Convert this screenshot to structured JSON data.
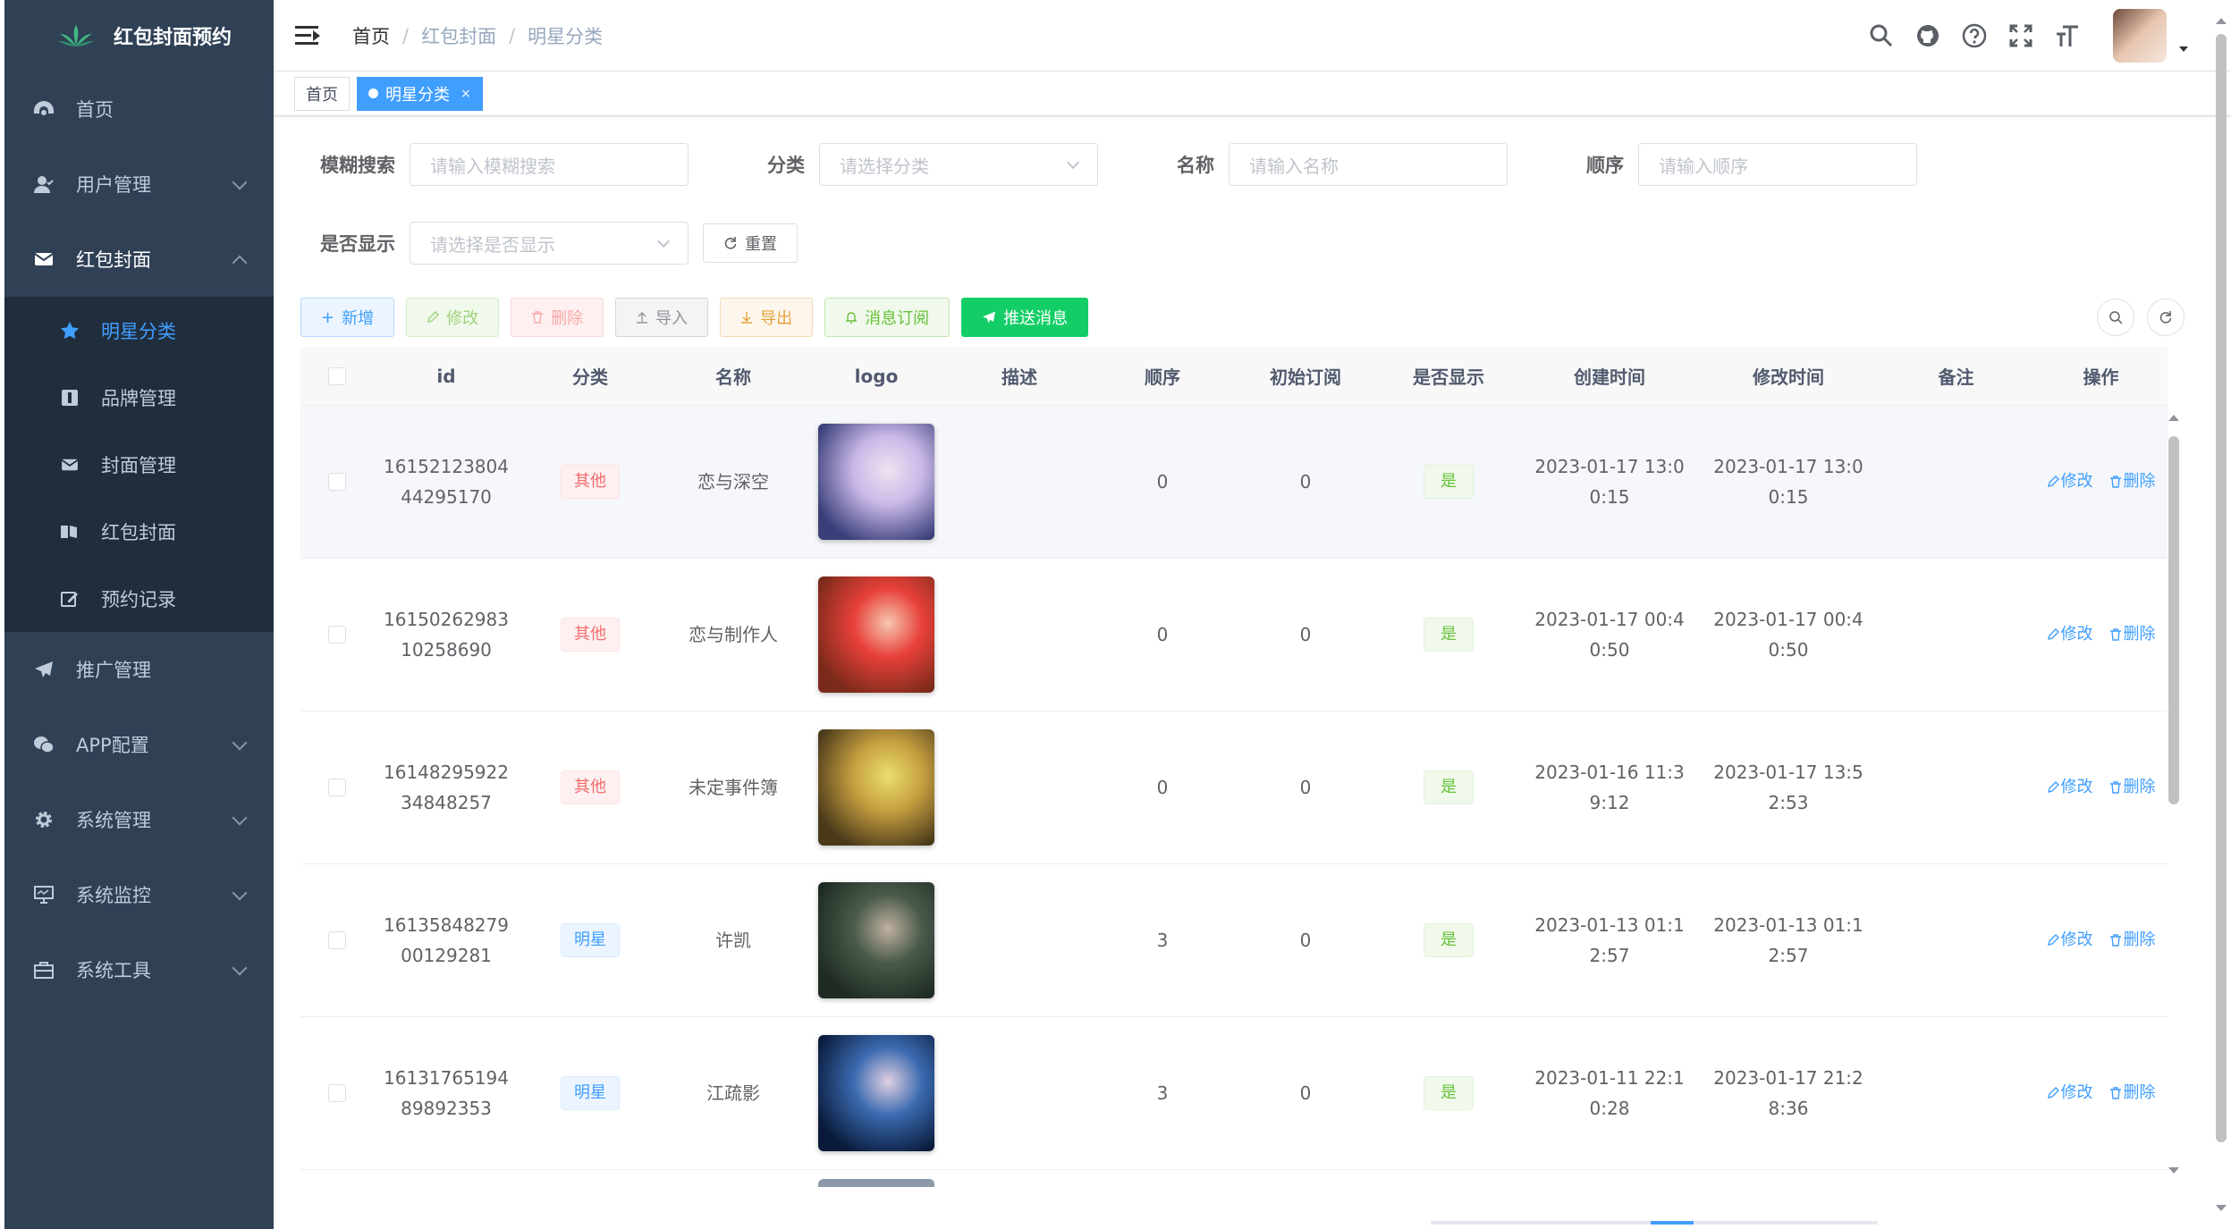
{
  "app": {
    "title": "红包封面预约"
  },
  "sidebar": {
    "items": [
      {
        "label": "首页",
        "icon": "dashboard-icon"
      },
      {
        "label": "用户管理",
        "icon": "user-icon"
      },
      {
        "label": "红包封面",
        "icon": "envelope-icon"
      },
      {
        "label": "推广管理",
        "icon": "paper-plane-icon"
      },
      {
        "label": "APP配置",
        "icon": "wechat-icon"
      },
      {
        "label": "系统管理",
        "icon": "gear-icon"
      },
      {
        "label": "系统监控",
        "icon": "monitor-icon"
      },
      {
        "label": "系统工具",
        "icon": "toolbox-icon"
      }
    ],
    "submenu": [
      {
        "label": "明星分类",
        "icon": "star-icon"
      },
      {
        "label": "品牌管理",
        "icon": "brand-icon"
      },
      {
        "label": "封面管理",
        "icon": "envelope-icon"
      },
      {
        "label": "红包封面",
        "icon": "book-icon"
      },
      {
        "label": "预约记录",
        "icon": "edit-icon"
      }
    ]
  },
  "navbar": {
    "breadcrumb": [
      "首页",
      "红包封面",
      "明星分类"
    ],
    "breadcrumb_sep": "/"
  },
  "tags": {
    "home": "首页",
    "active": "明星分类",
    "close": "×"
  },
  "search": {
    "fuzzy_label": "模糊搜索",
    "fuzzy_placeholder": "请输入模糊搜索",
    "category_label": "分类",
    "category_placeholder": "请选择分类",
    "name_label": "名称",
    "name_placeholder": "请输入名称",
    "order_label": "顺序",
    "order_placeholder": "请输入顺序",
    "show_label": "是否显示",
    "show_placeholder": "请选择是否显示",
    "reset": "重置"
  },
  "toolbar": {
    "add": "新增",
    "edit": "修改",
    "delete": "删除",
    "import": "导入",
    "export": "导出",
    "subscribe": "消息订阅",
    "push": "推送消息"
  },
  "table": {
    "headers": [
      "id",
      "分类",
      "名称",
      "logo",
      "描述",
      "顺序",
      "初始订阅",
      "是否显示",
      "创建时间",
      "修改时间",
      "备注",
      "操作"
    ],
    "edit_label": "修改",
    "delete_label": "删除",
    "rows": [
      {
        "id1": "16152123804",
        "id2": "44295170",
        "category": "其他",
        "category_type": "other",
        "name": "恋与深空",
        "order": "0",
        "subs": "0",
        "show": "是",
        "created1": "2023-01-17 13:0",
        "created2": "0:15",
        "modified1": "2023-01-17 13:0",
        "modified2": "0:15",
        "logo_colors": [
          "#3a3f7a",
          "#c9b8e8",
          "#f0e2f0"
        ]
      },
      {
        "id1": "16150262983",
        "id2": "10258690",
        "category": "其他",
        "category_type": "other",
        "name": "恋与制作人",
        "order": "0",
        "subs": "0",
        "show": "是",
        "created1": "2023-01-17 00:4",
        "created2": "0:50",
        "modified1": "2023-01-17 00:4",
        "modified2": "0:50",
        "logo_colors": [
          "#7a2a1a",
          "#e8403a",
          "#f6c8b0"
        ]
      },
      {
        "id1": "16148295922",
        "id2": "34848257",
        "category": "其他",
        "category_type": "other",
        "name": "未定事件簿",
        "order": "0",
        "subs": "0",
        "show": "是",
        "created1": "2023-01-16 11:3",
        "created2": "9:12",
        "modified1": "2023-01-17 13:5",
        "modified2": "2:53",
        "logo_colors": [
          "#4a3a1a",
          "#c8a040",
          "#e8e070"
        ]
      },
      {
        "id1": "16135848279",
        "id2": "00129281",
        "category": "明星",
        "category_type": "star",
        "name": "许凯",
        "order": "3",
        "subs": "0",
        "show": "是",
        "created1": "2023-01-13 01:1",
        "created2": "2:57",
        "modified1": "2023-01-13 01:1",
        "modified2": "2:57",
        "logo_colors": [
          "#1e2a22",
          "#4a5a4a",
          "#c0b0a0"
        ]
      },
      {
        "id1": "16131765194",
        "id2": "89892353",
        "category": "明星",
        "category_type": "star",
        "name": "江疏影",
        "order": "3",
        "subs": "0",
        "show": "是",
        "created1": "2023-01-11 22:1",
        "created2": "0:28",
        "modified1": "2023-01-17 21:2",
        "modified2": "8:36",
        "logo_colors": [
          "#0a1a3a",
          "#3a6ab0",
          "#e0d0e0"
        ]
      }
    ]
  },
  "colors": {
    "sidebar_bg": "#304156",
    "submenu_bg": "#1f2d3d",
    "accent": "#409eff",
    "push_button": "#13ce66"
  }
}
